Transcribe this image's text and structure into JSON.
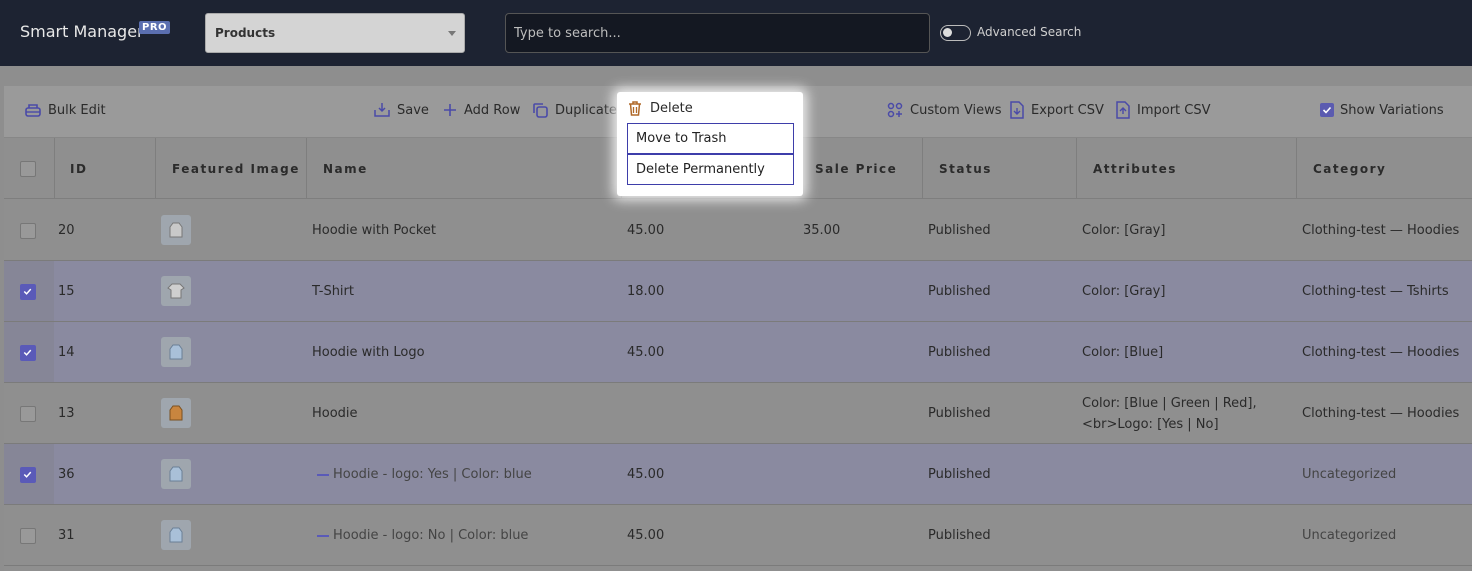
{
  "header": {
    "brand": "Smart Manager",
    "badge": "PRO",
    "dashboard_select": "Products",
    "search_placeholder": "Type to search...",
    "advanced_search_label": "Advanced Search"
  },
  "toolbar": {
    "bulk_edit": "Bulk Edit",
    "save": "Save",
    "add_row": "Add Row",
    "duplicate": "Duplicate",
    "delete": "Delete",
    "custom_views": "Custom Views",
    "export_csv": "Export CSV",
    "import_csv": "Import CSV",
    "show_variations": "Show Variations"
  },
  "delete_menu": {
    "move_to_trash": "Move to Trash",
    "delete_permanently": "Delete Permanently"
  },
  "columns": [
    "ID",
    "Featured Image",
    "Name",
    "Sale Price",
    "Status",
    "Attributes",
    "Category"
  ],
  "rows": [
    {
      "id": "20",
      "name": "Hoodie with Pocket",
      "price": "45.00",
      "sale": "35.00",
      "status": "Published",
      "attr1": "Color: [Gray]",
      "attr2": "",
      "category": "Clothing-test — Hoodies",
      "selected": false,
      "variation": false
    },
    {
      "id": "15",
      "name": "T-Shirt",
      "price": "18.00",
      "sale": "",
      "status": "Published",
      "attr1": "Color: [Gray]",
      "attr2": "",
      "category": "Clothing-test — Tshirts",
      "selected": true,
      "variation": false
    },
    {
      "id": "14",
      "name": "Hoodie with Logo",
      "price": "45.00",
      "sale": "",
      "status": "Published",
      "attr1": "Color: [Blue]",
      "attr2": "",
      "category": "Clothing-test — Hoodies",
      "selected": true,
      "variation": false
    },
    {
      "id": "13",
      "name": "Hoodie",
      "price": "",
      "sale": "",
      "status": "Published",
      "attr1": "Color: [Blue | Green | Red],",
      "attr2": "<br>Logo: [Yes | No]",
      "category": "Clothing-test — Hoodies",
      "selected": false,
      "variation": false
    },
    {
      "id": "36",
      "name": "Hoodie - logo: Yes | Color: blue",
      "price": "45.00",
      "sale": "",
      "status": "Published",
      "attr1": "",
      "attr2": "",
      "category": "Uncategorized",
      "selected": true,
      "variation": true
    },
    {
      "id": "31",
      "name": "Hoodie - logo: No | Color: blue",
      "price": "45.00",
      "sale": "",
      "status": "Published",
      "attr1": "",
      "attr2": "",
      "category": "Uncategorized",
      "selected": false,
      "variation": true
    }
  ],
  "colors": {
    "accent": "#5a5ab8",
    "topbar": "#1d2332"
  }
}
